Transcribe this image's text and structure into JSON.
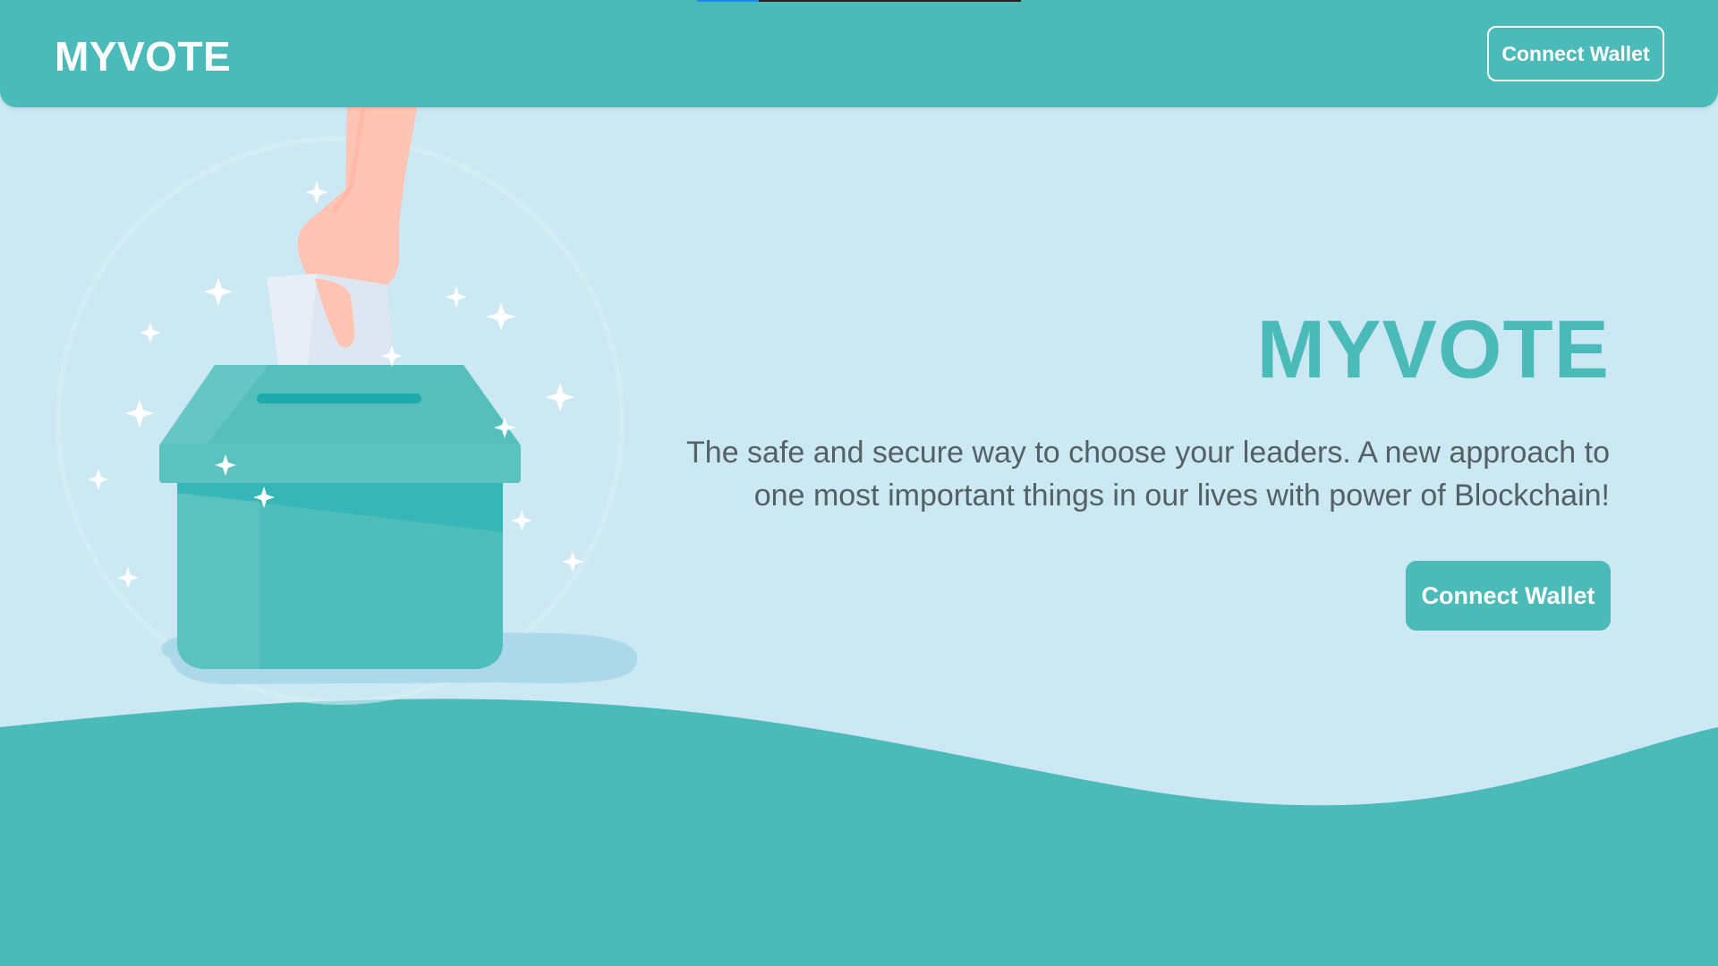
{
  "loading": {
    "progress": 0.19
  },
  "navbar": {
    "brand": "MYVOTE",
    "connect_label": "Connect Wallet"
  },
  "hero": {
    "title": "MYVOTE",
    "description": "The safe and secure way to choose your leaders. A new approach to one most important things in our lives with power of Blockchain!",
    "connect_label": "Connect Wallet",
    "illustration": "hand-casting-ballot-into-box-icon"
  },
  "colors": {
    "primary": "#4abbb9",
    "background": "#cbe8f3",
    "text": "#555f66",
    "white": "#ffffff"
  }
}
